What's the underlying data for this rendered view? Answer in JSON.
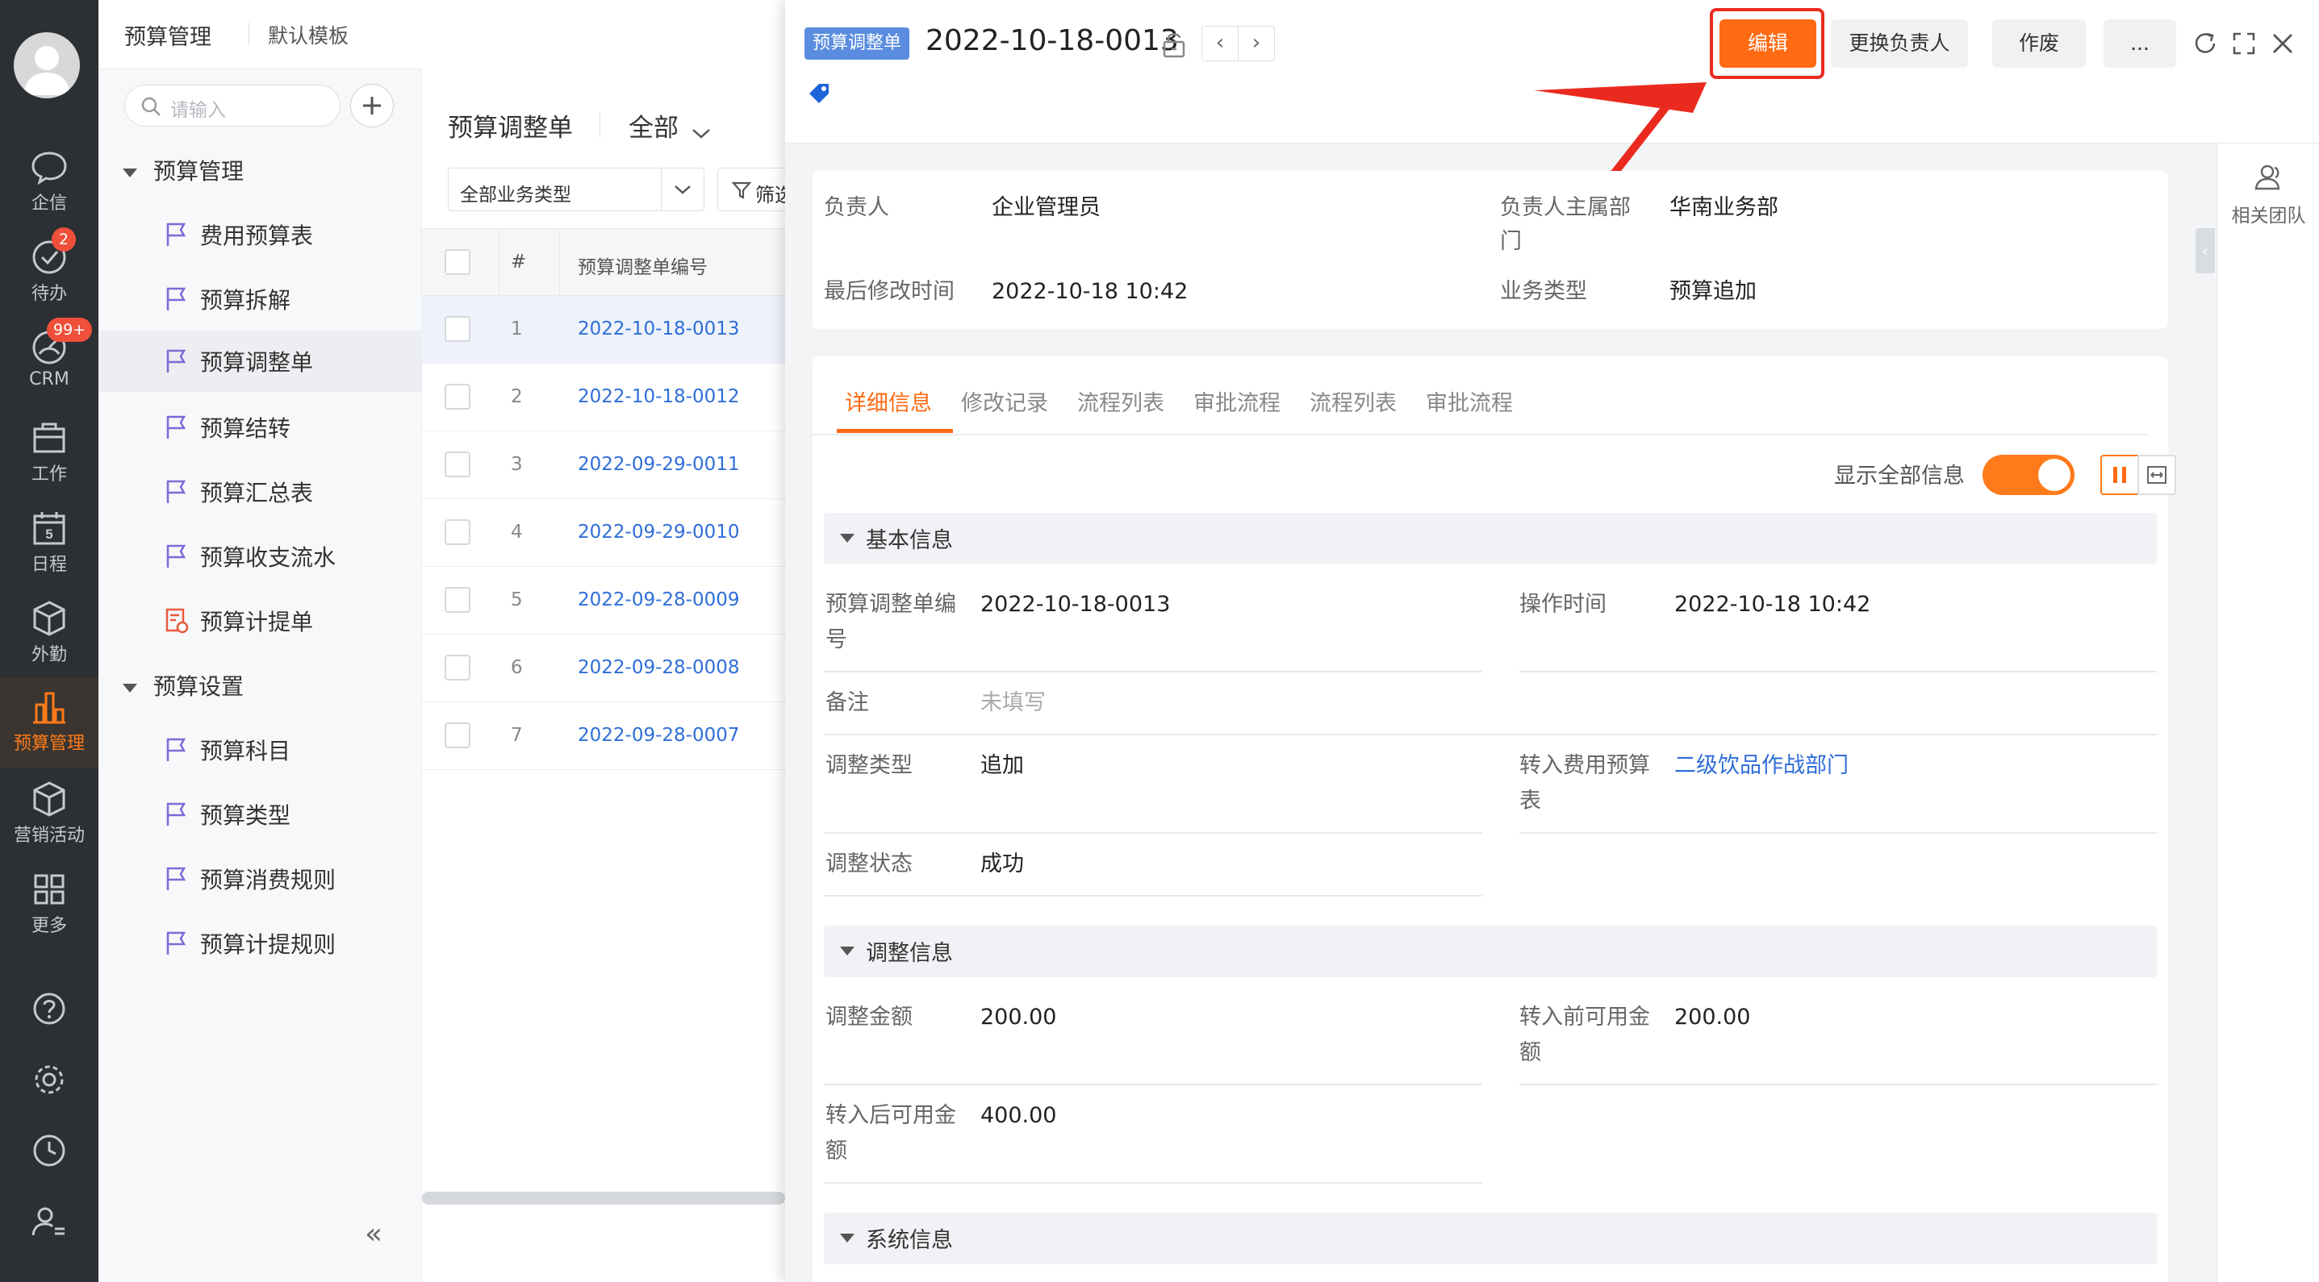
{
  "rail": {
    "items": [
      {
        "label": "企信",
        "icon": "chat-bubble-icon"
      },
      {
        "label": "待办",
        "icon": "check-circle-icon",
        "badge": "2"
      },
      {
        "label": "CRM",
        "icon": "crm-gauge-icon",
        "badge": "99+"
      },
      {
        "label": "工作",
        "icon": "briefcase-icon"
      },
      {
        "label": "日程",
        "icon": "calendar-icon",
        "day": "5"
      },
      {
        "label": "外勤",
        "icon": "cube-icon"
      },
      {
        "label": "预算管理",
        "icon": "bar-chart-icon",
        "active": true
      },
      {
        "label": "营销活动",
        "icon": "box-icon"
      },
      {
        "label": "更多",
        "icon": "grid-icon"
      }
    ],
    "bottom_icons": [
      "help-icon",
      "settings-icon",
      "clock-icon",
      "user-settings-icon"
    ],
    "active_color": "#ff7a1a"
  },
  "nav": {
    "title": "预算管理",
    "template": "默认模板",
    "search_placeholder": "请输入",
    "group1": "预算管理",
    "group1_items": [
      "费用预算表",
      "预算拆解",
      "预算调整单",
      "预算结转",
      "预算汇总表",
      "预算收支流水",
      "预算计提单"
    ],
    "group2": "预算设置",
    "group2_items": [
      "预算科目",
      "预算类型",
      "预算消费规则",
      "预算计提规则"
    ],
    "active_item": "预算调整单",
    "collapse": "«"
  },
  "list": {
    "title": "预算调整单",
    "scope": "全部",
    "biz_type": "全部业务类型",
    "filter": "筛选",
    "col_num": "#",
    "col_id": "预算调整单编号",
    "rows": [
      {
        "no": "1",
        "id": "2022-10-18-0013"
      },
      {
        "no": "2",
        "id": "2022-10-18-0012"
      },
      {
        "no": "3",
        "id": "2022-09-29-0011"
      },
      {
        "no": "4",
        "id": "2022-09-29-0010"
      },
      {
        "no": "5",
        "id": "2022-09-28-0009"
      },
      {
        "no": "6",
        "id": "2022-09-28-0008"
      },
      {
        "no": "7",
        "id": "2022-09-28-0007"
      }
    ]
  },
  "detail": {
    "tag": "预算调整单",
    "doc_no": "2022-10-18-0013",
    "nav_prev": "‹",
    "nav_next": "›",
    "buttons": {
      "edit": "编辑",
      "change_owner": "更换负责人",
      "void": "作废",
      "more": "..."
    },
    "summary": {
      "owner_label": "负责人",
      "owner": "企业管理员",
      "dept_label_1": "负责人主属部",
      "dept_label_2": "门",
      "dept": "华南业务部",
      "modified_label": "最后修改时间",
      "modified": "2022-10-18 10:42",
      "biz_label": "业务类型",
      "biz": "预算追加"
    },
    "tabs": [
      "详细信息",
      "修改记录",
      "流程列表",
      "审批流程",
      "流程列表",
      "审批流程"
    ],
    "show_all_label": "显示全部信息",
    "show_all_on": true,
    "related_team": "相关团队",
    "sections": {
      "basic": "基本信息",
      "adjust": "调整信息",
      "system": "系统信息"
    },
    "fields": {
      "no_label_1": "预算调整单编",
      "no_label_2": "号",
      "no": "2022-10-18-0013",
      "optime_label": "操作时间",
      "optime": "2022-10-18 10:42",
      "remark_label": "备注",
      "remark": "未填写",
      "adj_type_label": "调整类型",
      "adj_type": "追加",
      "into_label_1": "转入费用预算",
      "into_label_2": "表",
      "into": "二级饮品作战部门",
      "status_label": "调整状态",
      "status": "成功",
      "amount_label": "调整金额",
      "amount": "200.00",
      "before_label_1": "转入前可用金",
      "before_label_2": "额",
      "before": "200.00",
      "after_label_1": "转入后可用金",
      "after_label_2": "额",
      "after": "400.00"
    },
    "accent": "#ff6a13",
    "link_color": "#2e6ed8",
    "highlight_color": "#ea2a1f"
  }
}
